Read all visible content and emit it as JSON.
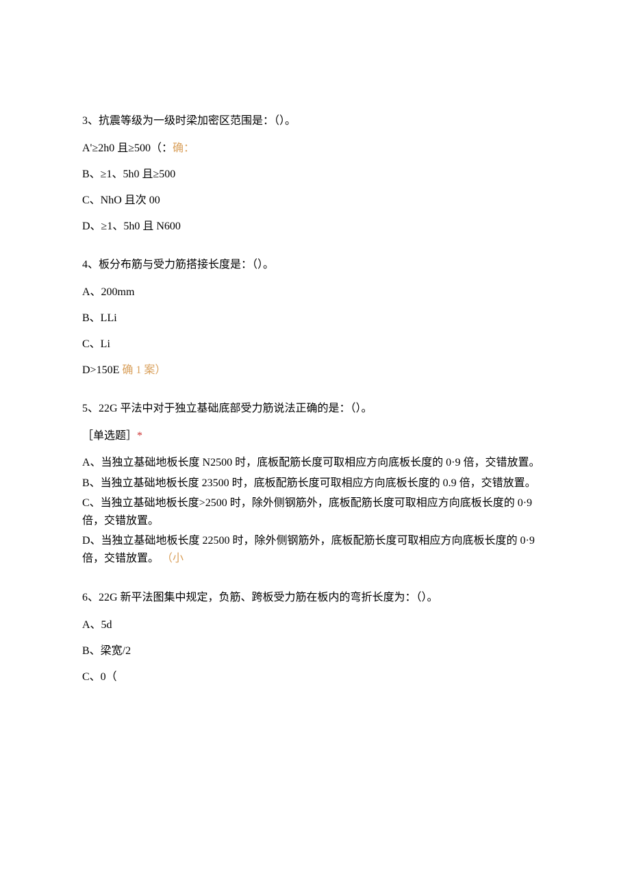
{
  "q3": {
    "question": "3、抗震等级为一级时梁加密区范围是：（）。",
    "optA_prefix": "A'≥2h0 且≥500（：",
    "optA_annotation": "确：",
    "optB": "B、≥1、5h0 且≥500",
    "optC": "C、NhO 且次 00",
    "optD": "D、≥1、5h0 且 N600"
  },
  "q4": {
    "question": "4、板分布筋与受力筋搭接长度是：（）。",
    "optA": "A、200mm",
    "optB": "B、LLi",
    "optC": "C、Li",
    "optD_prefix": "D>150E ",
    "optD_annotation": "确 1 案）"
  },
  "q5": {
    "question": "5、22G 平法中对于独立基础底部受力筋说法正确的是：（）。",
    "tag_prefix": "［单选题］",
    "tag_star": "*",
    "optA": "A、当独立基础地板长度 N2500 时，底板配筋长度可取相应方向底板长度的 0·9 倍，交错放置。",
    "optB": "B、当独立基础地板长度 23500 时，底板配筋长度可取相应方向底板长度的 0.9 倍，交错放置。",
    "optC": "C、当独立基础地板长度>2500 时，除外侧钢筋外，底板配筋长度可取相应方向底板长度的 0·9 倍，交错放置。",
    "optD_prefix": "D、当独立基础地板长度 22500 时，除外侧钢筋外，底板配筋长度可取相应方向底板长度的 0·9 倍，交错放置。",
    "optD_annotation": "（小"
  },
  "q6": {
    "question": "6、22G 新平法图集中规定，负筋、跨板受力筋在板内的弯折长度为：（）。",
    "optA": "A、5d",
    "optB": "B、梁宽/2",
    "optC": "C、0（"
  }
}
